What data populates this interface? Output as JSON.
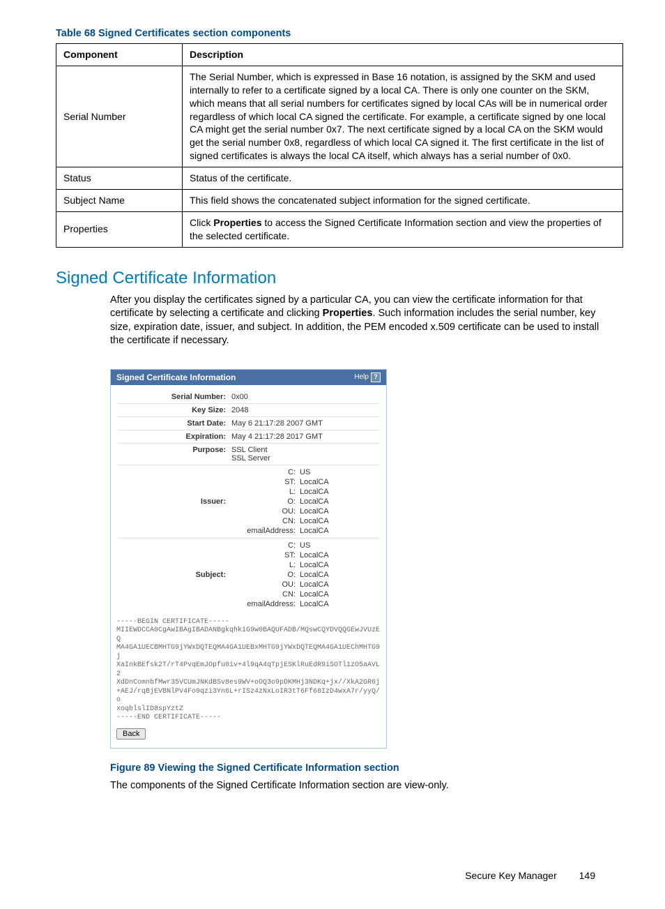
{
  "table": {
    "caption": "Table 68 Signed Certificates section components",
    "headers": [
      "Component",
      "Description"
    ],
    "rows": [
      {
        "component": "Serial Number",
        "description": "The Serial Number, which is expressed in Base 16 notation, is assigned by the SKM and used internally to refer to a certificate signed by a local CA. There is only one counter on the SKM, which means that all serial numbers for certificates signed by local CAs will be in numerical order regardless of which local CA signed the certificate. For example, a certificate signed by one local CA might get the serial number 0x7. The next certificate signed by a local CA on the SKM would get the serial number 0x8, regardless of which local CA signed it. The first certificate in the list of signed certificates is always the local CA itself, which always has a serial number of 0x0."
      },
      {
        "component": "Status",
        "description": "Status of the certificate."
      },
      {
        "component": "Subject Name",
        "description": "This field shows the concatenated subject information for the signed certificate."
      },
      {
        "component": "Properties",
        "description_html": true
      }
    ]
  },
  "section": {
    "heading": "Signed Certificate Information",
    "body_pre": "After you display the certificates signed by a particular CA, you can view the certificate information for that certificate by selecting a certificate and clicking ",
    "body_bold": "Properties",
    "body_post": ". Such information includes the serial number, key size, expiration date, issuer, and subject. In addition, the PEM encoded x.509 certificate can be used to install the certificate if necessary."
  },
  "figure": {
    "title": "Signed Certificate Information",
    "help": "Help",
    "fields": {
      "serial_label": "Serial Number:",
      "serial_value": "0x00",
      "keysize_label": "Key Size:",
      "keysize_value": "2048",
      "start_label": "Start Date:",
      "start_value": "May  6 21:17:28 2007 GMT",
      "exp_label": "Expiration:",
      "exp_value": "May  4 21:17:28 2017 GMT",
      "purpose_label": "Purpose:",
      "purpose_value1": "SSL Client",
      "purpose_value2": "SSL Server"
    },
    "issuer_label": "Issuer:",
    "subject_label": "Subject:",
    "dn": [
      {
        "k": "C:",
        "v": "US"
      },
      {
        "k": "ST:",
        "v": "LocalCA"
      },
      {
        "k": "L:",
        "v": "LocalCA"
      },
      {
        "k": "O:",
        "v": "LocalCA"
      },
      {
        "k": "OU:",
        "v": "LocalCA"
      },
      {
        "k": "CN:",
        "v": "LocalCA"
      },
      {
        "k": "emailAddress:",
        "v": "LocalCA"
      }
    ],
    "pem": "-----BEGIN CERTIFICATE-----\nMIIEWDCCA0CgAwIBAgIBADANBgkqhkiG9w0BAQUFADB/MQswCQYDVQQGEwJVUzEQ\nMA4GA1UECBMHTG9jYWxDQTEQMA4GA1UEBxMHTG9jYWxDQTEQMA4GA1UEChMHTG9j\nXaInkBEfsk2T/rT4PvqEmJOpfu0iv+4l9qA4qTpjESKlRuEdR9iSOTl1zO5aAVL2\nXdDnComnbfMwr35VCUmJNKdBSv8es9WV+oOQ3o9pDKMHj3NDKq+jx//XkA2GR6j\n+AEJ/rqBjEVBNlPV4Fo9qzi3Yn6L+rISz4zNxLoIR3tT6Ff68IzD4wxA7r/yyQ/o\nxoqblslID8spYztZ\n-----END CERTIFICATE-----",
    "back": "Back"
  },
  "figure_caption": "Figure 89 Viewing the Signed Certificate Information section",
  "post_figure_text": "The components of the Signed Certificate Information section are view-only.",
  "footer": {
    "title": "Secure Key Manager",
    "page": "149"
  },
  "props_desc": {
    "pre": "Click ",
    "bold": "Properties",
    "post": " to access the Signed Certificate Information section and view the properties of the selected certificate."
  }
}
